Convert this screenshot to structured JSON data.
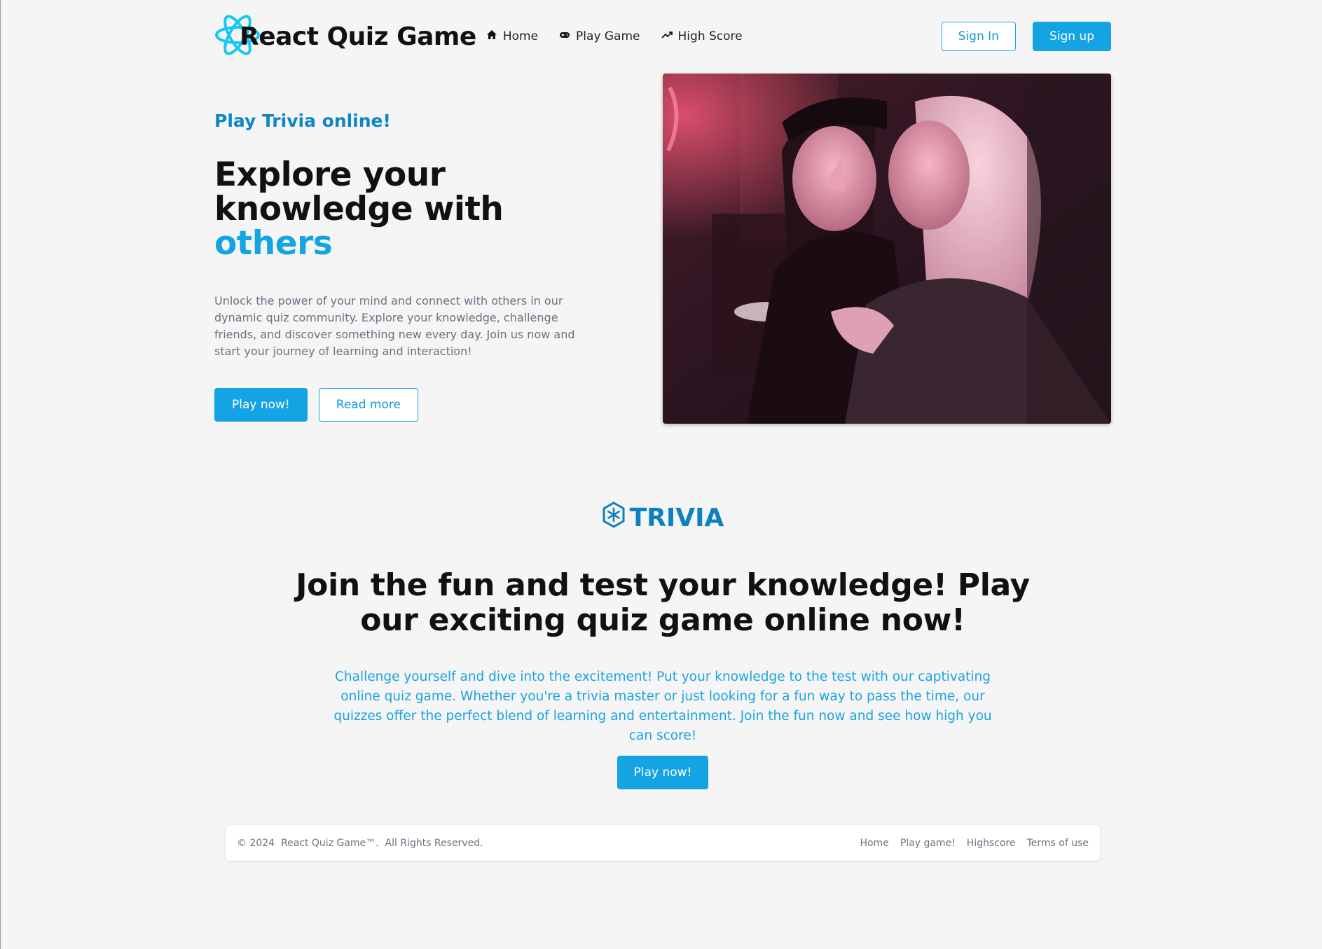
{
  "header": {
    "brand_title": "React Quiz Game",
    "nav": [
      {
        "label": "Home",
        "icon": "home-icon"
      },
      {
        "label": "Play Game",
        "icon": "gamepad-icon"
      },
      {
        "label": "High Score",
        "icon": "trending-up-icon"
      }
    ],
    "sign_in": "Sign In",
    "sign_up": "Sign up"
  },
  "hero": {
    "eyebrow": "Play Trivia online!",
    "title_main": "Explore your knowledge with ",
    "title_accent": "others",
    "description": "Unlock the power of your mind and connect with others in our dynamic quiz community. Explore your knowledge, challenge friends, and discover something new every day. Join us now and start your journey of learning and interaction!",
    "play_button": "Play now!",
    "read_more_button": "Read more"
  },
  "section2": {
    "logo_text": "TRIVIA",
    "title": "Join the fun and test your knowledge! Play our exciting quiz game online now!",
    "description": "Challenge yourself and dive into the excitement! Put your knowledge to the test with our captivating online quiz game. Whether you're a trivia master or just looking for a fun way to pass the time, our quizzes offer the perfect blend of learning and entertainment. Join the fun now and see how high you can score!",
    "play_button": "Play now!"
  },
  "footer": {
    "copyright": "© 2024  React Quiz Game™.  All Rights Reserved.",
    "links": [
      "Home",
      "Play game!",
      "Highscore",
      "Terms of use"
    ]
  },
  "colors": {
    "accent": "#14a3e3",
    "accent_dark": "#0e86c5",
    "text_muted": "#6a7180",
    "background": "#f5f5f5"
  }
}
